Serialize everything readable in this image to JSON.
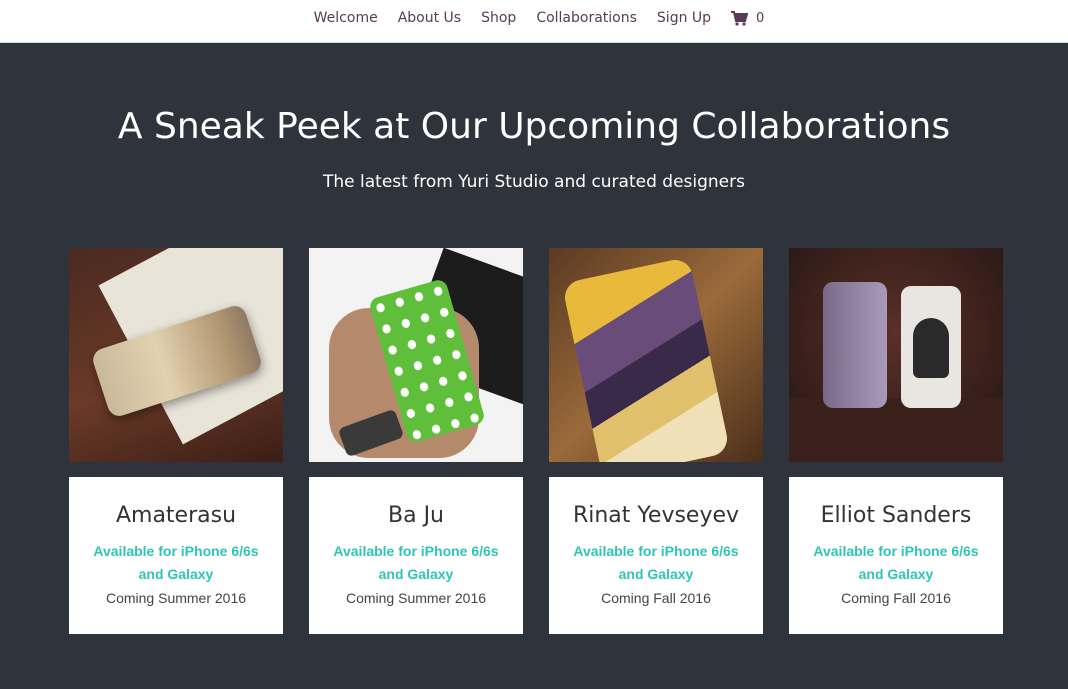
{
  "nav": {
    "items": [
      "Welcome",
      "About Us",
      "Shop",
      "Collaborations",
      "Sign Up"
    ],
    "cart_icon": "shopping-cart-icon",
    "cart_count": "0"
  },
  "hero": {
    "title": "A Sneak Peek at Our Upcoming Collaborations",
    "subtitle": "The latest from Yuri Studio and curated designers"
  },
  "cards": [
    {
      "name": "Amaterasu",
      "availability": "Available for iPhone 6/6s and Galaxy",
      "coming": "Coming Summer 2016"
    },
    {
      "name": "Ba Ju",
      "availability": "Available for iPhone 6/6s and Galaxy",
      "coming": "Coming Summer 2016"
    },
    {
      "name": "Rinat Yevseyev",
      "availability": "Available for iPhone 6/6s and Galaxy",
      "coming": "Coming Fall 2016"
    },
    {
      "name": "Elliot Sanders",
      "availability": "Available for iPhone 6/6s and Galaxy",
      "coming": "Coming Fall 2016"
    }
  ],
  "colors": {
    "background": "#2f333b",
    "nav_text": "#5a3a57",
    "accent": "#2ec4b6"
  }
}
